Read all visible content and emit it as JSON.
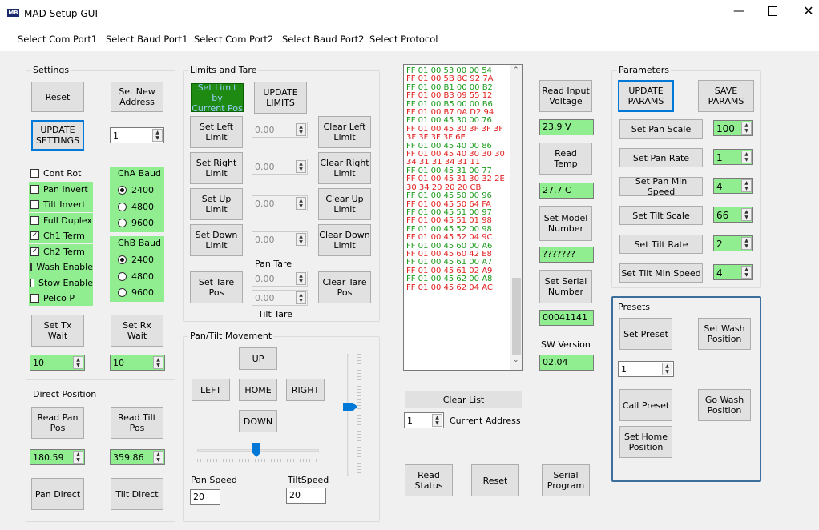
{
  "window": {
    "title": "MAD Setup GUI",
    "app_icon": "app-logo-icon"
  },
  "menu": [
    "Select Com Port1",
    "Select Baud Port1",
    "Select Com Port2",
    "Select Baud Port2",
    "Select Protocol"
  ],
  "settings": {
    "title": "Settings",
    "reset": "Reset",
    "set_new_address": "Set New\nAddress",
    "update_settings": "UPDATE\nSETTINGS",
    "address_value": "1",
    "checks": [
      {
        "label": "Cont Rot",
        "checked": false
      },
      {
        "label": "Pan Invert",
        "checked": false
      },
      {
        "label": "Tilt Invert",
        "checked": false
      },
      {
        "label": "Full Duplex",
        "checked": false
      },
      {
        "label": "Ch1 Term",
        "checked": true
      },
      {
        "label": "Ch2 Term",
        "checked": true
      },
      {
        "label": "Wash Enable",
        "checked": false
      },
      {
        "label": "Stow Enable",
        "checked": false
      },
      {
        "label": "Pelco P",
        "checked": false
      }
    ],
    "cha_title": "ChA Baud",
    "cha": [
      "2400",
      "4800",
      "9600"
    ],
    "chb_title": "ChB Baud",
    "chb": [
      "2400",
      "4800",
      "9600"
    ],
    "set_tx_wait": "Set Tx\nWait",
    "set_rx_wait": "Set Rx\nWait",
    "tx_value": "10",
    "rx_value": "10"
  },
  "direct": {
    "title": "Direct Position",
    "read_pan": "Read Pan\nPos",
    "read_tilt": "Read Tilt\nPos",
    "pan_value": "180.59",
    "tilt_value": "359.86",
    "pan_direct": "Pan Direct",
    "tilt_direct": "Tilt Direct"
  },
  "limits": {
    "title": "Limits and Tare",
    "set_limit_current": "Set Limit by\nCurrent Pos",
    "update_limits": "UPDATE\nLIMITS",
    "set_left": "Set Left\nLimit",
    "clear_left": "Clear Left\nLimit",
    "set_right": "Set Right\nLimit",
    "clear_right": "Clear Right\nLimit",
    "set_up": "Set Up\nLimit",
    "clear_up": "Clear Up\nLimit",
    "set_down": "Set Down\nLimit",
    "clear_down": "Clear Down\nLimit",
    "left_val": "0.00",
    "right_val": "0.00",
    "up_val": "0.00",
    "down_val": "0.00",
    "pan_tare": "Pan Tare",
    "tilt_tare": "Tilt Tare",
    "set_tare": "Set Tare\nPos",
    "clear_tare": "Clear Tare\nPos",
    "pan_tare_val": "0.00",
    "tilt_tare_val": "0.00"
  },
  "movement": {
    "title": "Pan/Tilt Movement",
    "up": "UP",
    "left": "LEFT",
    "home": "HOME",
    "right": "RIGHT",
    "down": "DOWN",
    "pan_speed_label": "Pan Speed",
    "tilt_speed_label": "TiltSpeed",
    "pan_speed": "20",
    "tilt_speed": "20"
  },
  "log": {
    "lines": [
      {
        "t": "FF 01 00 53 00 00 54",
        "c": "#1a9a1a"
      },
      {
        "t": "FF 01 00 5B 8C 92 7A",
        "c": "#e02020"
      },
      {
        "t": "FF 01 00 B1 00 00 B2",
        "c": "#1a9a1a"
      },
      {
        "t": "FF 01 00 B3 09 55 12",
        "c": "#e02020"
      },
      {
        "t": "FF 01 00 B5 00 00 B6",
        "c": "#1a9a1a"
      },
      {
        "t": "FF 01 00 B7 0A D2 94",
        "c": "#e02020"
      },
      {
        "t": "FF 01 00 45 30 00 76",
        "c": "#1a9a1a"
      },
      {
        "t": "FF 01 00 45 30 3F 3F 3F",
        "c": "#e02020"
      },
      {
        "t": "3F 3F 3F 3F 6E",
        "c": "#e02020"
      },
      {
        "t": "FF 01 00 45 40 00 86",
        "c": "#1a9a1a"
      },
      {
        "t": "FF 01 00 45 40 30 30 30",
        "c": "#e02020"
      },
      {
        "t": "34 31 31 34 31 11",
        "c": "#e02020"
      },
      {
        "t": "FF 01 00 45 31 00 77",
        "c": "#1a9a1a"
      },
      {
        "t": "FF 01 00 45 31 30 32 2E",
        "c": "#e02020"
      },
      {
        "t": "30 34 20 20 20 CB",
        "c": "#e02020"
      },
      {
        "t": "FF 01 00 45 50 00 96",
        "c": "#1a9a1a"
      },
      {
        "t": "FF 01 00 45 50 64 FA",
        "c": "#e02020"
      },
      {
        "t": "FF 01 00 45 51 00 97",
        "c": "#1a9a1a"
      },
      {
        "t": "FF 01 00 45 51 01 98",
        "c": "#e02020"
      },
      {
        "t": "FF 01 00 45 52 00 98",
        "c": "#1a9a1a"
      },
      {
        "t": "FF 01 00 45 52 04 9C",
        "c": "#e02020"
      },
      {
        "t": "FF 01 00 45 60 00 A6",
        "c": "#1a9a1a"
      },
      {
        "t": "FF 01 00 45 60 42 E8",
        "c": "#e02020"
      },
      {
        "t": "FF 01 00 45 61 00 A7",
        "c": "#1a9a1a"
      },
      {
        "t": "FF 01 00 45 61 02 A9",
        "c": "#e02020"
      },
      {
        "t": "FF 01 00 45 62 00 A8",
        "c": "#1a9a1a"
      },
      {
        "t": "FF 01 00 45 62 04 AC",
        "c": "#e02020"
      }
    ],
    "clear_list": "Clear List",
    "current_address_label": "Current Address",
    "current_address": "1",
    "read_status": "Read\nStatus",
    "reset": "Reset",
    "serial_program": "Serial\nProgram"
  },
  "info": {
    "read_voltage": "Read Input\nVoltage",
    "voltage": "23.9 V",
    "read_temp": "Read\nTemp",
    "temp": "27.7 C",
    "set_model": "Set Model\nNumber",
    "model": "???????",
    "set_serial": "Set Serial\nNumber",
    "serial": "00041141",
    "sw_label": "SW Version",
    "sw": "02.04"
  },
  "params": {
    "title": "Parameters",
    "update": "UPDATE\nPARAMS",
    "save": "SAVE\nPARAMS",
    "rows": [
      {
        "label": "Set Pan Scale",
        "value": "100"
      },
      {
        "label": "Set Pan Rate",
        "value": "1"
      },
      {
        "label": "Set Pan Min Speed",
        "value": "4"
      },
      {
        "label": "Set Tilt Scale",
        "value": "66"
      },
      {
        "label": "Set Tilt Rate",
        "value": "2"
      },
      {
        "label": "Set Tilt Min Speed",
        "value": "4"
      }
    ]
  },
  "presets": {
    "title": "Presets",
    "set_preset": "Set Preset",
    "set_wash": "Set Wash\nPosition",
    "preset_value": "1",
    "call_preset": "Call Preset",
    "go_wash": "Go Wash\nPosition",
    "set_home": "Set Home\nPosition"
  }
}
